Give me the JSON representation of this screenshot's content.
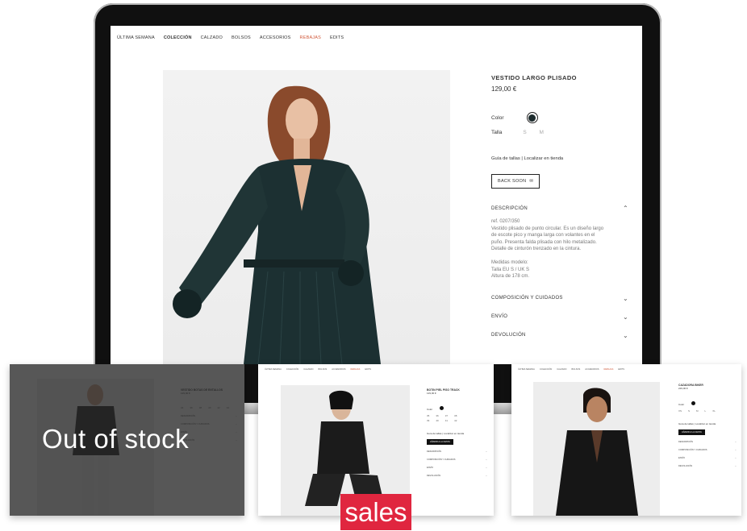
{
  "main_page": {
    "nav": [
      "ÚLTIMA SEMANA",
      "COLECCIÓN",
      "CALZADO",
      "BOLSOS",
      "ACCESORIOS",
      "REBAJAS",
      "EDITS"
    ],
    "product": {
      "title": "VESTIDO LARGO PLISADO",
      "price": "129,00 €",
      "color_label": "Color",
      "size_label": "Talla",
      "sizes": [
        "S",
        "M"
      ],
      "guide_links": "Guía de tallas | Localizar en tienda",
      "back_soon": "BACK SOON",
      "description_title": "DESCRIPCIÓN",
      "description_lines": [
        "ref. 0207/350",
        "Vestido plisado de punto circular. Es un diseño largo",
        "de escote pico y manga larga con volantes en el",
        "puño. Presenta falda plisada con hilo metalizado.",
        "Detalle de cinturón trenzado en la cintura.",
        "",
        "Medidas modelo:",
        "Talla EU S / UK S",
        "Altura de 178 cm."
      ],
      "accordion": [
        "COMPOSICIÓN Y CUIDADOS",
        "ENVÍO",
        "DEVOLUCIÓN"
      ]
    }
  },
  "cards": {
    "out_of_stock": {
      "overlay_text": "Out of stock",
      "title": "VESTIDO BOTAS DE ENTALLOS",
      "price": "129,00 €",
      "sizes": [
        "34",
        "36",
        "38",
        "40",
        "42",
        "44"
      ],
      "accordion": [
        "DESCRIPCIÓN",
        "COMPOSICIÓN Y CUIDADOS",
        "ENVÍO",
        "DEVOLUCIÓN"
      ]
    },
    "sales": {
      "badge": "sales",
      "title": "BOTIN PIEL PISO TRACK",
      "price": "129,00 €",
      "sizes_row1": [
        "35",
        "36",
        "37",
        "38"
      ],
      "sizes_row2": [
        "39",
        "40",
        "41",
        "42"
      ],
      "links": "Guía de tallas | Localizar en tienda",
      "button": "AÑADIR A LA CESTA",
      "accordion": [
        "DESCRIPCIÓN",
        "COMPOSICIÓN Y CUIDADOS",
        "ENVÍO",
        "DEVOLUCIÓN"
      ]
    },
    "third": {
      "title": "CAZADORA BIKER",
      "price": "229,00 €",
      "sizes": [
        "XS",
        "S",
        "M",
        "L",
        "XL"
      ],
      "links": "Guía de tallas | Localizar en tienda",
      "button": "AÑADIR A LA CESTA",
      "accordion": [
        "DESCRIPCIÓN",
        "COMPOSICIÓN Y CUIDADOS",
        "ENVÍO",
        "DEVOLUCIÓN"
      ]
    }
  },
  "colors": {
    "sale_nav": "#d0583a",
    "badge": "#e0263f",
    "dress": "#1d2b2d"
  }
}
